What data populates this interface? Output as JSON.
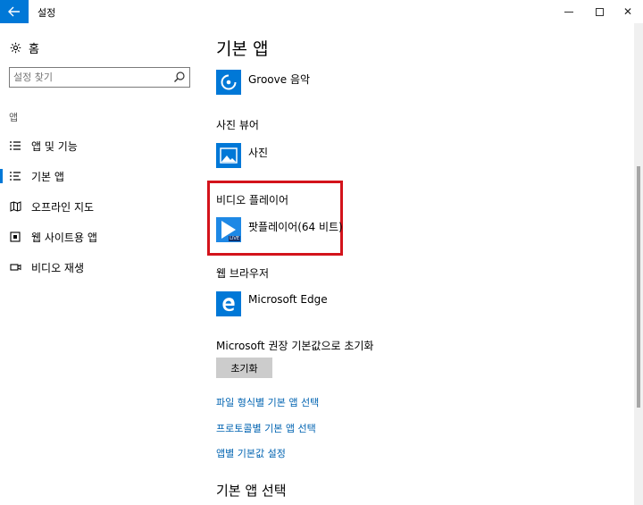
{
  "window": {
    "title": "설정",
    "back_icon": "arrow-left-icon",
    "minimize_icon": "minimize-icon",
    "maximize_icon": "maximize-icon",
    "close_glyph": "✕"
  },
  "sidebar": {
    "home_label": "홈",
    "search_placeholder": "설정 찾기",
    "section_label": "앱",
    "items": [
      {
        "label": "앱 및 기능",
        "icon": "list-icon",
        "selected": false
      },
      {
        "label": "기본 앱",
        "icon": "default-apps-icon",
        "selected": true
      },
      {
        "label": "오프라인 지도",
        "icon": "map-icon",
        "selected": false
      },
      {
        "label": "웹 사이트용 앱",
        "icon": "web-app-icon",
        "selected": false
      },
      {
        "label": "비디오 재생",
        "icon": "video-icon",
        "selected": false
      }
    ]
  },
  "main": {
    "title": "기본 앱",
    "music": {
      "app_name": "Groove 음악",
      "icon": "groove-music-icon"
    },
    "photo": {
      "category": "사진 뷰어",
      "app_name": "사진",
      "icon": "photos-icon"
    },
    "video": {
      "category": "비디오 플레이어",
      "app_name": "팟플레이어(64 비트)",
      "icon": "potplayer-icon",
      "badge": "LIVE"
    },
    "browser": {
      "category": "웹 브라우저",
      "app_name": "Microsoft Edge",
      "icon": "edge-icon"
    },
    "reset": {
      "label": "Microsoft 권장 기본값으로 초기화",
      "button": "초기화"
    },
    "links": [
      "파일 형식별 기본 앱 선택",
      "프로토콜별 기본 앱 선택",
      "앱별 기본값 설정"
    ],
    "subtitle": "기본 앱 선택"
  },
  "colors": {
    "accent": "#0078d7",
    "link": "#0063b1",
    "highlight": "#d3131b"
  }
}
